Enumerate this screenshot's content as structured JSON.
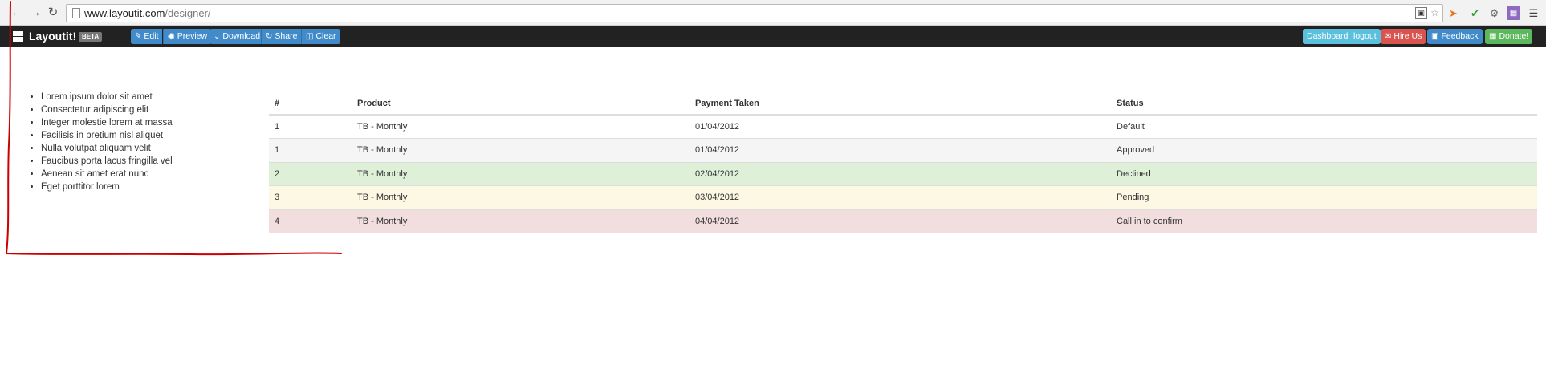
{
  "browser": {
    "url_host": "www.layoutit.com",
    "url_path": "/designer/",
    "back_icon": "back-arrow-icon",
    "forward_icon": "forward-arrow-icon",
    "reload_icon": "reload-icon",
    "menu_icon": "hamburger-menu-icon"
  },
  "navbar": {
    "brand": "Layoutit!",
    "badge": "BETA",
    "left_buttons": [
      {
        "label": "Edit",
        "icon": "edit-icon"
      },
      {
        "label": "Preview",
        "icon": "eye-icon"
      },
      {
        "label": "Download",
        "icon": "chevron-down-icon"
      },
      {
        "label": "Share",
        "icon": "share-icon"
      },
      {
        "label": "Clear",
        "icon": "trash-icon"
      }
    ],
    "right_buttons": [
      {
        "label": "Dashboard"
      },
      {
        "label": "logout"
      },
      {
        "label": "Hire Us",
        "icon": "envelope-icon"
      },
      {
        "label": "Feedback",
        "icon": "comment-icon"
      },
      {
        "label": "Donate!",
        "icon": "grid-icon"
      }
    ]
  },
  "list": {
    "items": [
      "Lorem ipsum dolor sit amet",
      "Consectetur adipiscing elit",
      "Integer molestie lorem at massa",
      "Facilisis in pretium nisl aliquet",
      "Nulla volutpat aliquam velit",
      "Faucibus porta lacus fringilla vel",
      "Aenean sit amet erat nunc",
      "Eget porttitor lorem"
    ]
  },
  "table": {
    "headers": [
      "#",
      "Product",
      "Payment Taken",
      "Status"
    ],
    "rows": [
      [
        "1",
        "TB - Monthly",
        "01/04/2012",
        "Default"
      ],
      [
        "1",
        "TB - Monthly",
        "01/04/2012",
        "Approved"
      ],
      [
        "2",
        "TB - Monthly",
        "02/04/2012",
        "Declined"
      ],
      [
        "3",
        "TB - Monthly",
        "03/04/2012",
        "Pending"
      ],
      [
        "4",
        "TB - Monthly",
        "04/04/2012",
        "Call in to confirm"
      ]
    ]
  },
  "colors": {
    "navbar_bg": "#222222",
    "primary": "#428bca",
    "info": "#5bc0de",
    "danger": "#d9534f",
    "success": "#5cb85c",
    "annotation": "#cc0000"
  }
}
